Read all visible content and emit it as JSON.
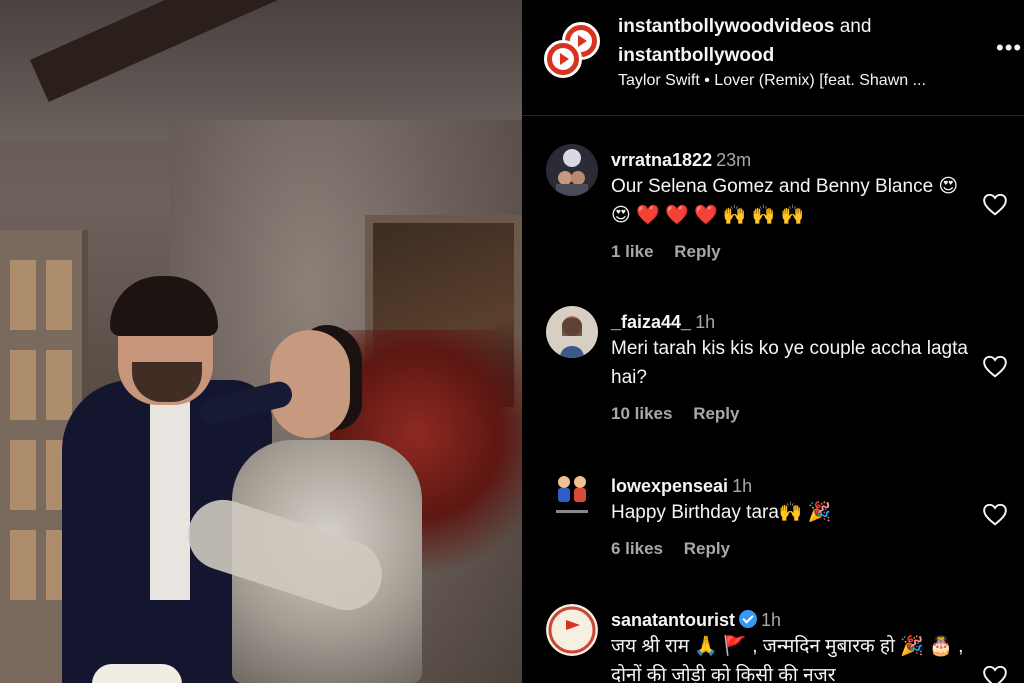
{
  "header": {
    "user_1": "instantbollywoodvideos",
    "conjunction": "and",
    "user_2": "instantbollywood",
    "music": "Taylor Swift • Lover (Remix) [feat. Shawn ...",
    "more_label": "•••"
  },
  "comments": [
    {
      "username": "vrratna1822",
      "time": "23m",
      "text": "Our Selena Gomez and Benny Blance 😍 😍 ❤️ ❤️ ❤️ 🙌 🙌 🙌",
      "likes": "1 like",
      "reply": "Reply"
    },
    {
      "username": "_faiza44_",
      "time": "1h",
      "text": "Meri tarah kis kis ko ye couple accha lagta hai?",
      "likes": "10 likes",
      "reply": "Reply"
    },
    {
      "username": "lowexpenseai",
      "time": "1h",
      "text": "Happy Birthday tara🙌 🎉",
      "likes": "6 likes",
      "reply": "Reply"
    },
    {
      "username": "sanatantourist",
      "time": "1h",
      "text": "जय श्री राम 🙏 🚩 , जन्मदिन मुबारक हो 🎉 🎂 , दोनों की जोड़ी को किसी की नजर",
      "verified": true
    }
  ],
  "colors": {
    "background": "#000000",
    "text": "#f5f5f5",
    "secondary_text": "#a8a8a8",
    "verified": "#3897f0",
    "logo_red": "#d8331f"
  },
  "icons": [
    "more-options-icon",
    "heart-icon",
    "verified-badge-icon",
    "logo-icon"
  ]
}
